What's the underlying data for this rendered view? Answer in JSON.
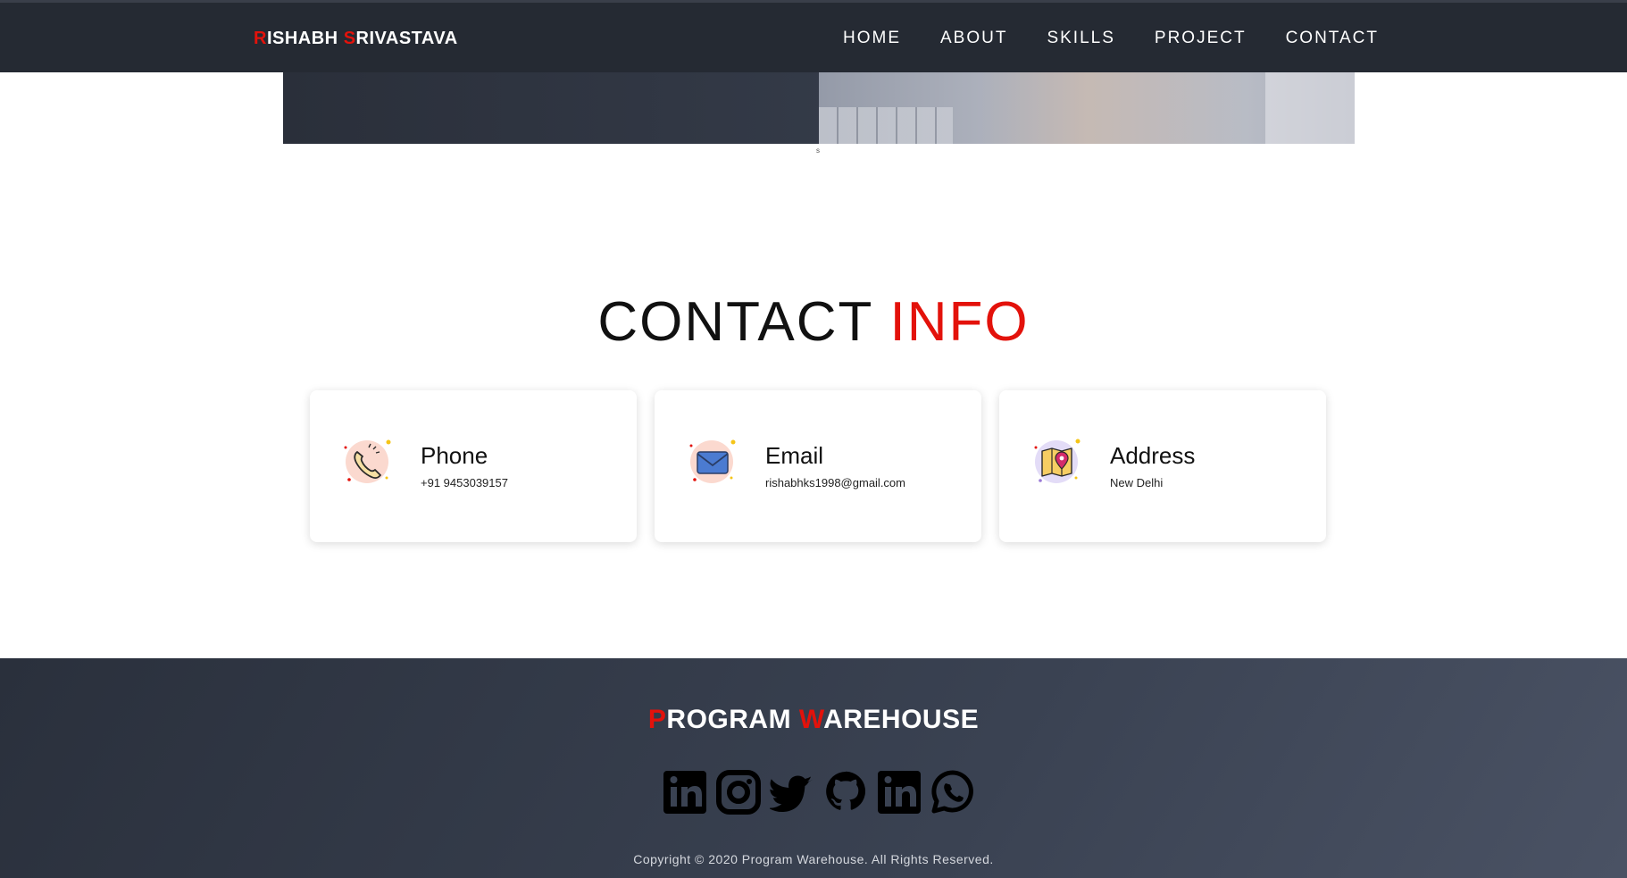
{
  "header": {
    "brand_first_initial": "R",
    "brand_first_rest": "ISHABH ",
    "brand_last_initial": "S",
    "brand_last_rest": "RIVASTAVA",
    "nav": [
      "HOME",
      "ABOUT",
      "SKILLS",
      "PROJECT",
      "CONTACT"
    ]
  },
  "hero": {
    "caption": "s"
  },
  "contact": {
    "title_main": "CONTACT ",
    "title_accent": "INFO",
    "cards": [
      {
        "title": "Phone",
        "value": "+91 9453039157",
        "icon": "phone-icon"
      },
      {
        "title": "Email",
        "value": "rishabhks1998@gmail.com",
        "icon": "email-icon"
      },
      {
        "title": "Address",
        "value": "New Delhi",
        "icon": "map-pin-icon"
      }
    ]
  },
  "footer": {
    "brand_first_initial": "P",
    "brand_first_rest": "ROGRAM ",
    "brand_last_initial": "W",
    "brand_last_rest": "AREHOUSE",
    "socials": [
      "linkedin-icon",
      "instagram-icon",
      "twitter-icon",
      "github-icon",
      "linkedin-icon",
      "whatsapp-icon"
    ],
    "copyright": "Copyright © 2020 Program Warehouse. All Rights Reserved."
  },
  "colors": {
    "accent": "#e3120b",
    "navbar": "#252a33",
    "footer": "#333a48"
  }
}
